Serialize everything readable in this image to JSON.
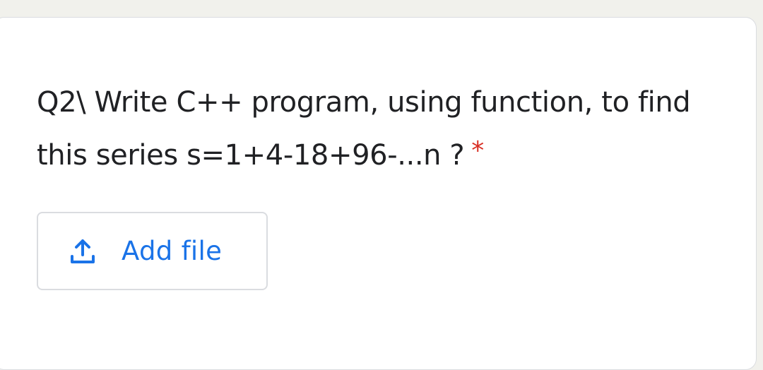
{
  "question": {
    "text": "Q2\\ Write C++ program, using function, to find this series s=1+4-18+96-...n ?",
    "required_marker": "*"
  },
  "upload": {
    "button_label": "Add file",
    "icon": "upload-icon"
  },
  "colors": {
    "background": "#f1f1ec",
    "card": "#ffffff",
    "text": "#202124",
    "required": "#d93025",
    "accent": "#1a73e8",
    "border": "#dadce0"
  }
}
